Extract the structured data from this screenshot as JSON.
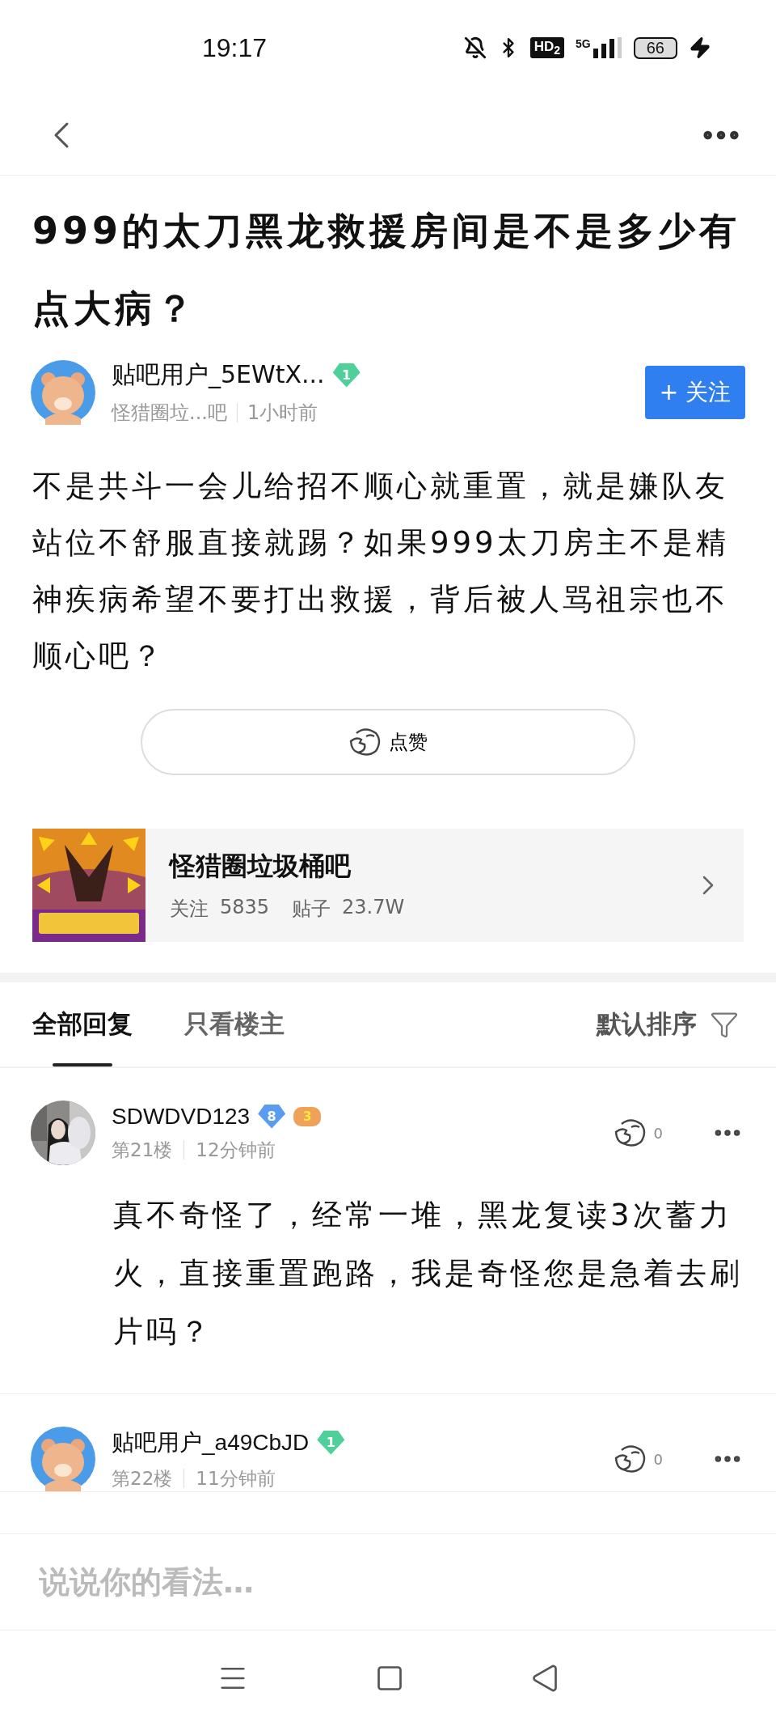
{
  "status_bar": {
    "time": "19:17",
    "hd": "HD$_{2}$",
    "network": "5G",
    "battery": "66"
  },
  "post": {
    "title": "999的太刀黑龙救援房间是不是多少有点大病？",
    "author": {
      "name": "贴吧用户_5EWtX...",
      "level": "1",
      "forum": "怪猎圈垃...吧",
      "time": "1小时前",
      "follow_button": "+ 关注"
    },
    "body": "不是共斗一会儿给招不顺心就重置，就是嫌队友站位不舒服直接就踢？如果999太刀房主不是精神疾病希望不要打出救援，背后被人骂祖宗也不顺心吧？",
    "like_button": "点赞"
  },
  "forum_card": {
    "name": "怪猎圈垃圾桶吧",
    "stats": [
      {
        "label": "关注",
        "value": "5835"
      },
      {
        "label": "贴子",
        "value": "23.7W"
      }
    ]
  },
  "tabs": [
    {
      "label": "全部回复",
      "selected": true
    },
    {
      "label": "只看楼主",
      "selected": false
    }
  ],
  "sort": {
    "label": "默认排序"
  },
  "replies": [
    {
      "name": "SDWDVD123",
      "level": "8",
      "game_level": "3",
      "floor": "第21楼",
      "time": "12分钟前",
      "likes": "0",
      "text": "真不奇怪了，经常一堆，黑龙复读3次蓄力火，直接重置跑路，我是奇怪您是急着去刷片吗？"
    },
    {
      "kind": "bear",
      "name": "贴吧用户_a49CbJD",
      "level": "1",
      "floor": "第22楼",
      "time": "11分钟前",
      "likes": "0"
    }
  ],
  "comment_bar": {
    "placeholder": "说说你的看法…"
  }
}
